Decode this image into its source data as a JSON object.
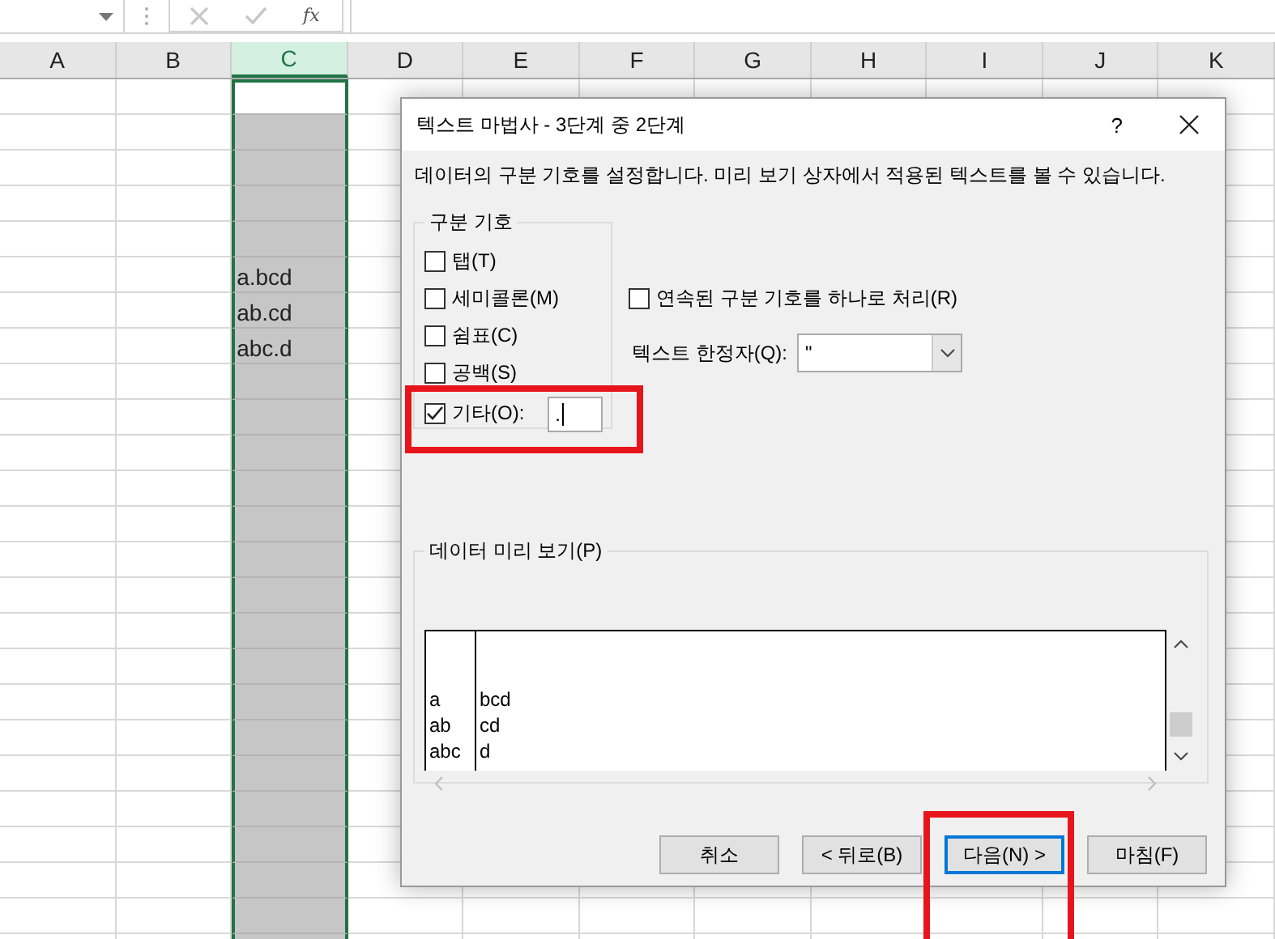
{
  "formula_bar": {
    "function_label": "fx"
  },
  "sheet": {
    "columns": [
      {
        "label": "A",
        "selected": false
      },
      {
        "label": "B",
        "selected": false
      },
      {
        "label": "C",
        "selected": true
      },
      {
        "label": "D",
        "selected": false
      },
      {
        "label": "E",
        "selected": false
      },
      {
        "label": "F",
        "selected": false
      },
      {
        "label": "G",
        "selected": false
      },
      {
        "label": "H",
        "selected": false
      },
      {
        "label": "I",
        "selected": false
      },
      {
        "label": "J",
        "selected": false
      },
      {
        "label": "K",
        "selected": false
      }
    ],
    "column_c_values": [
      "a.bcd",
      "ab.cd",
      "abc.d"
    ]
  },
  "dialog": {
    "title": "텍스트 마법사 - 3단계 중 2단계",
    "help": "?",
    "description": "데이터의 구분 기호를 설정합니다. 미리 보기 상자에서 적용된 텍스트를 볼 수 있습니다.",
    "delimiters": {
      "title": "구분 기호",
      "options": [
        {
          "kind": "plain",
          "label": "탭(T)",
          "checked": false,
          "highlighted": false
        },
        {
          "kind": "plain",
          "label": "세미콜론(M)",
          "checked": false,
          "highlighted": false
        },
        {
          "kind": "plain",
          "label": "쉼표(C)",
          "checked": false,
          "highlighted": false
        },
        {
          "kind": "plain",
          "label": "공백(S)",
          "checked": false,
          "highlighted": false
        },
        {
          "kind": "other",
          "label": "기타(O):",
          "checked": true,
          "highlighted": true,
          "value": "."
        }
      ]
    },
    "consecutive": {
      "label": "연속된 구분 기호를 하나로 처리(R)",
      "checked": false
    },
    "qualifier": {
      "label": "텍스트 한정자(Q):",
      "value": "\""
    },
    "preview": {
      "title": "데이터 미리 보기(P)",
      "columns": [
        [
          "a",
          "ab",
          "abc"
        ],
        [
          "bcd",
          "cd",
          "d"
        ]
      ]
    },
    "buttons": [
      {
        "label": "취소",
        "default": false,
        "highlighted": false
      },
      {
        "label": "< 뒤로(B)",
        "default": false,
        "highlighted": false
      },
      {
        "label": "다음(N) >",
        "default": true,
        "highlighted": true
      },
      {
        "label": "마침(F)",
        "default": false,
        "highlighted": false
      }
    ]
  }
}
